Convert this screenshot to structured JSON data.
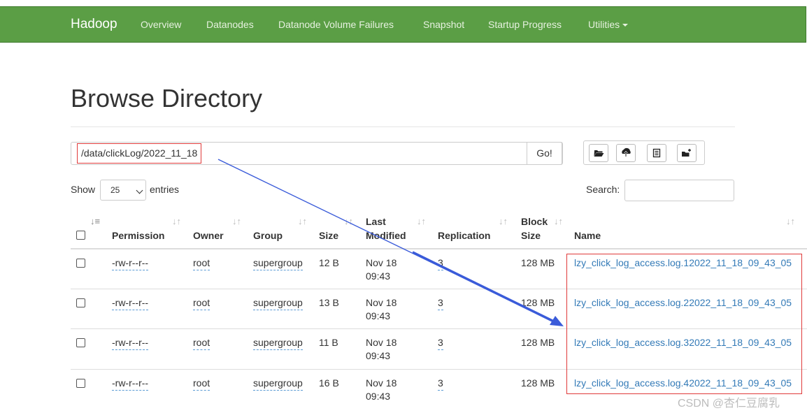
{
  "navbar": {
    "brand": "Hadoop",
    "items": [
      "Overview",
      "Datanodes",
      "Datanode Volume Failures",
      "Snapshot",
      "Startup Progress",
      "Utilities"
    ],
    "dropdown_icon": "caret-down-icon"
  },
  "page": {
    "title": "Browse Directory"
  },
  "path_bar": {
    "value": "/data/clickLog/2022_11_18",
    "go_label": "Go!"
  },
  "toolbar_icons": [
    "folder-open-icon",
    "upload-icon",
    "list-icon",
    "folder-plus-icon"
  ],
  "entries": {
    "show_label": "Show",
    "selected": "25",
    "entries_label": "entries"
  },
  "search": {
    "label": "Search:",
    "value": ""
  },
  "table": {
    "columns": [
      "Permission",
      "Owner",
      "Group",
      "Size",
      "Last Modified",
      "Replication",
      "Block Size",
      "Name"
    ],
    "header_lines": {
      "last_modified": [
        "Last",
        "Modified"
      ],
      "block_size": [
        "Block",
        "Size"
      ]
    },
    "rows": [
      {
        "permission": "-rw-r--r--",
        "owner": "root",
        "group": "supergroup",
        "size": "12 B",
        "date": "Nov 18",
        "time": "09:43",
        "replication": "3",
        "block_size": "128 MB",
        "name": "lzy_click_log_access.log.12022_11_18_09_43_05"
      },
      {
        "permission": "-rw-r--r--",
        "owner": "root",
        "group": "supergroup",
        "size": "13 B",
        "date": "Nov 18",
        "time": "09:43",
        "replication": "3",
        "block_size": "128 MB",
        "name": "lzy_click_log_access.log.22022_11_18_09_43_05"
      },
      {
        "permission": "-rw-r--r--",
        "owner": "root",
        "group": "supergroup",
        "size": "11 B",
        "date": "Nov 18",
        "time": "09:43",
        "replication": "3",
        "block_size": "128 MB",
        "name": "lzy_click_log_access.log.32022_11_18_09_43_05"
      },
      {
        "permission": "-rw-r--r--",
        "owner": "root",
        "group": "supergroup",
        "size": "16 B",
        "date": "Nov 18",
        "time": "09:43",
        "replication": "3",
        "block_size": "128 MB",
        "name": "lzy_click_log_access.log.42022_11_18_09_43_05"
      }
    ]
  },
  "annotation": {
    "arrow_color": "#3a5bd9",
    "box_color": "#e03a3a"
  },
  "watermark": "CSDN @杏仁豆腐乳"
}
